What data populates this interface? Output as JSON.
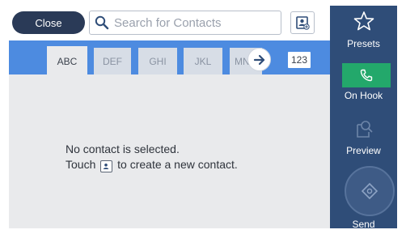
{
  "header": {
    "close_label": "Close",
    "search_placeholder": "Search for Contacts"
  },
  "tabs": {
    "items": [
      "ABC",
      "DEF",
      "GHI",
      "JKL",
      "MN"
    ],
    "active": "ABC",
    "numeric": "123"
  },
  "message": {
    "line1": "No contact is selected.",
    "line2_before": "Touch",
    "line2_after": "to create a new contact."
  },
  "sidebar": {
    "presets_label": "Presets",
    "onhook_label": "On Hook",
    "preview_label": "Preview",
    "send_label": "Send"
  },
  "colors": {
    "tab_bar": "#4d8be0",
    "sidebar": "#2f4d78",
    "close_button": "#2a3a57",
    "onhook_button": "#23a86b"
  },
  "icons": [
    "search-icon",
    "add-contact-icon",
    "arrow-right-icon",
    "star-icon",
    "phone-icon",
    "preview-icon",
    "send-diamond-icon"
  ]
}
